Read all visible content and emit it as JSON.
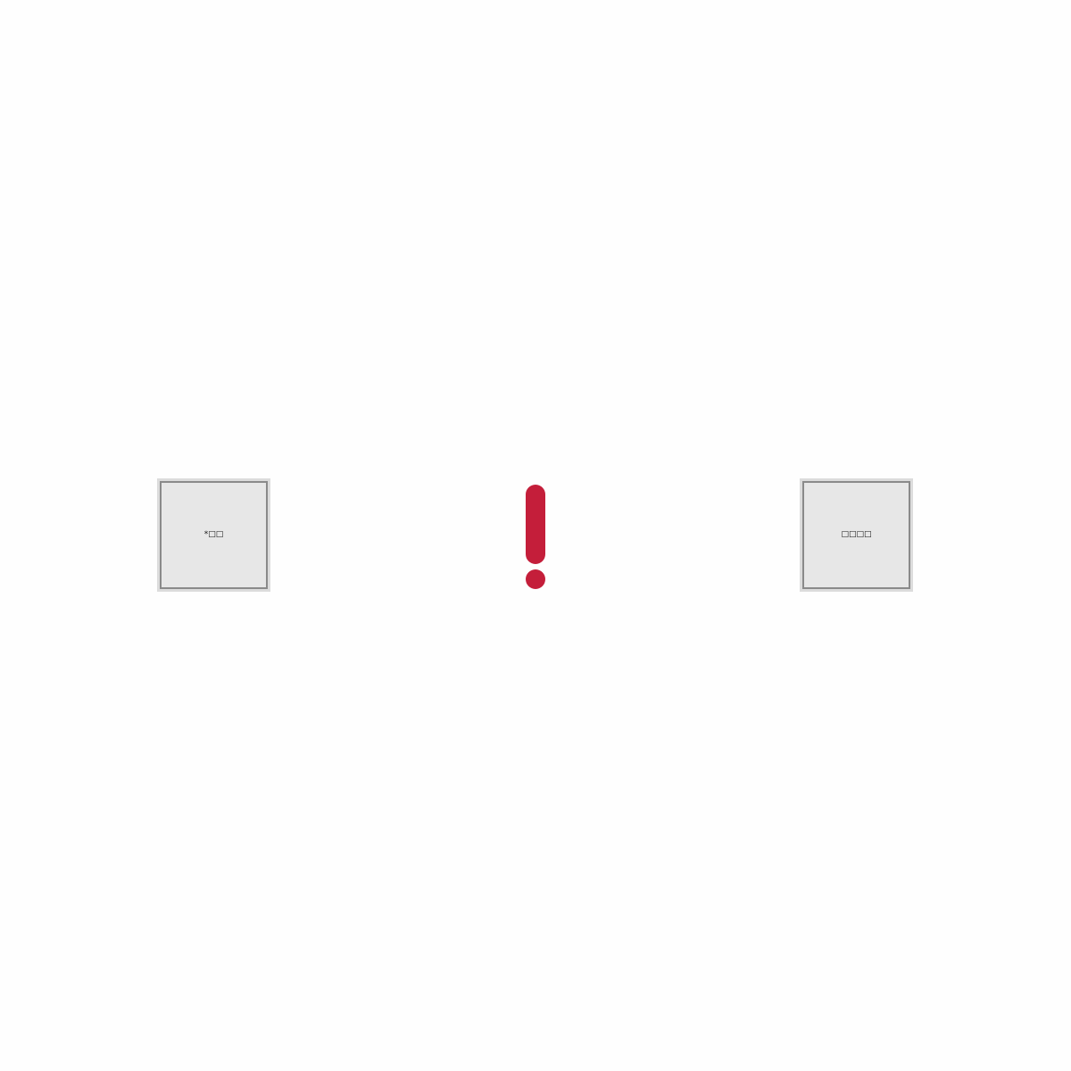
{
  "choices": {
    "left": {
      "label": "*□□"
    },
    "right": {
      "label": "□□□□"
    }
  },
  "alert": {
    "icon": "exclamation-icon",
    "color": "#c41e3a"
  },
  "colors": {
    "background": "#fefefe",
    "tile_fill": "#e7e7e7",
    "tile_border": "#8a8a8a",
    "tile_halo": "#dcdcdc"
  }
}
